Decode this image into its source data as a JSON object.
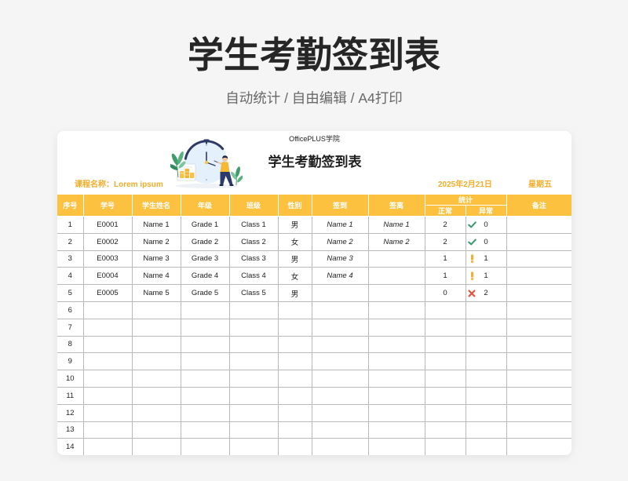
{
  "page": {
    "title": "学生考勤签到表",
    "subtitle": "自动统计 / 自由编辑 / A4打印"
  },
  "sheet": {
    "brand": "OfficePLUS学院",
    "title": "学生考勤签到表",
    "illustration": "clock-attendance-illustration",
    "course_label": "课程名称：",
    "course_name": "Lorem ipsum",
    "date": "2025年2月21日",
    "weekday": "星期五",
    "columns": {
      "index": "序号",
      "student_id": "学号",
      "name": "学生姓名",
      "grade": "年级",
      "class": "班级",
      "gender": "性别",
      "sign_in": "签到",
      "sign_out": "签离",
      "stats": "统计",
      "normal": "正常",
      "abnormal": "异常",
      "remarks": "备注"
    },
    "rows": [
      {
        "index": "1",
        "student_id": "E0001",
        "name": "Name 1",
        "grade": "Grade 1",
        "class": "Class 1",
        "gender": "男",
        "sign_in": "Name 1",
        "sign_out": "Name 1",
        "normal": "2",
        "abnormal_icon": "check-icon",
        "abnormal": "0",
        "remarks": ""
      },
      {
        "index": "2",
        "student_id": "E0002",
        "name": "Name 2",
        "grade": "Grade 2",
        "class": "Class 2",
        "gender": "女",
        "sign_in": "Name 2",
        "sign_out": "Name 2",
        "normal": "2",
        "abnormal_icon": "check-icon",
        "abnormal": "0",
        "remarks": ""
      },
      {
        "index": "3",
        "student_id": "E0003",
        "name": "Name 3",
        "grade": "Grade 3",
        "class": "Class 3",
        "gender": "男",
        "sign_in": "Name 3",
        "sign_out": "",
        "normal": "1",
        "abnormal_icon": "exclamation-icon",
        "abnormal": "1",
        "remarks": ""
      },
      {
        "index": "4",
        "student_id": "E0004",
        "name": "Name 4",
        "grade": "Grade 4",
        "class": "Class 4",
        "gender": "女",
        "sign_in": "Name 4",
        "sign_out": "",
        "normal": "1",
        "abnormal_icon": "exclamation-icon",
        "abnormal": "1",
        "remarks": ""
      },
      {
        "index": "5",
        "student_id": "E0005",
        "name": "Name 5",
        "grade": "Grade 5",
        "class": "Class 5",
        "gender": "男",
        "sign_in": "",
        "sign_out": "",
        "normal": "0",
        "abnormal_icon": "cross-icon",
        "abnormal": "2",
        "remarks": ""
      },
      {
        "index": "6"
      },
      {
        "index": "7"
      },
      {
        "index": "8"
      },
      {
        "index": "9"
      },
      {
        "index": "10"
      },
      {
        "index": "11"
      },
      {
        "index": "12"
      },
      {
        "index": "13"
      },
      {
        "index": "14"
      }
    ]
  },
  "colors": {
    "accent": "#fcc13e",
    "info_text": "#f2ad2a",
    "check": "#3b9a6c",
    "warning": "#f2b02e",
    "error": "#e2533b",
    "grid": "#b9b9b9"
  }
}
